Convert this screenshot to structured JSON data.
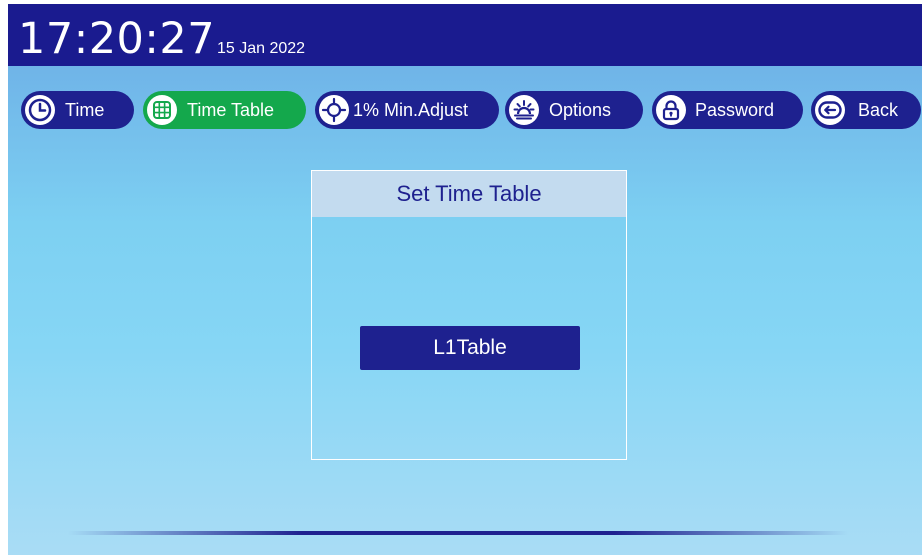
{
  "header": {
    "time": "17:20:27",
    "date": "15 Jan 2022"
  },
  "nav": {
    "items": [
      {
        "label": "Time",
        "icon": "clock-icon"
      },
      {
        "label": "Time Table",
        "icon": "grid-icon",
        "active": true
      },
      {
        "label": "1% Min.Adjust",
        "icon": "crosshair-icon"
      },
      {
        "label": "Options",
        "icon": "sunrise-icon"
      },
      {
        "label": "Password",
        "icon": "lock-icon"
      },
      {
        "label": "Back",
        "icon": "back-arrow-icon"
      }
    ]
  },
  "panel": {
    "title": "Set Time Table",
    "table_button": "L1Table"
  },
  "colors": {
    "navy": "#1e218f",
    "active_green": "#14a84c",
    "panel_header": "#c3dbef"
  }
}
